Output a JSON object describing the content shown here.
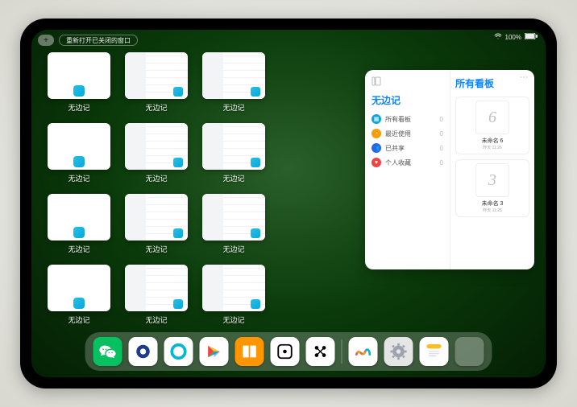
{
  "status": {
    "battery": "100%",
    "wifi": "●"
  },
  "top": {
    "reopen_label": "重新打开已关闭的窗口"
  },
  "app_label": "无边记",
  "windows": [
    {
      "type": "blank"
    },
    {
      "type": "cal"
    },
    {
      "type": "cal"
    },
    {
      "type": "blank"
    },
    {
      "type": "cal"
    },
    {
      "type": "cal"
    },
    {
      "type": "blank"
    },
    {
      "type": "cal"
    },
    {
      "type": "cal"
    },
    {
      "type": "blank"
    },
    {
      "type": "cal"
    },
    {
      "type": "cal"
    }
  ],
  "panel": {
    "left_title": "无边记",
    "items": [
      {
        "icon": "grid",
        "color": "#0ea5d9",
        "label": "所有看板",
        "count": "0"
      },
      {
        "icon": "clock",
        "color": "#f59e0b",
        "label": "最近使用",
        "count": "0"
      },
      {
        "icon": "share",
        "color": "#2563eb",
        "label": "已共享",
        "count": "0"
      },
      {
        "icon": "heart",
        "color": "#ef4444",
        "label": "个人收藏",
        "count": "0"
      }
    ],
    "right_title": "所有看板",
    "boards": [
      {
        "glyph": "6",
        "title": "未命名 6",
        "sub": "昨天 11:26"
      },
      {
        "glyph": "3",
        "title": "未命名 3",
        "sub": "昨天 11:25"
      }
    ]
  },
  "dock": {
    "apps": [
      {
        "name": "wechat",
        "bg": "#07c160",
        "glyph": "wechat"
      },
      {
        "name": "browser1",
        "bg": "#ffffff",
        "glyph": "circle-blue"
      },
      {
        "name": "browser2",
        "bg": "#ffffff",
        "glyph": "circle-cyan"
      },
      {
        "name": "play",
        "bg": "#ffffff",
        "glyph": "play-color"
      },
      {
        "name": "books",
        "bg": "#ff9500",
        "glyph": "book"
      },
      {
        "name": "dice",
        "bg": "#ffffff",
        "glyph": "dice"
      },
      {
        "name": "dots",
        "bg": "#ffffff",
        "glyph": "dots"
      }
    ],
    "recent": [
      {
        "name": "freeform",
        "bg": "#ffffff",
        "glyph": "freeform"
      },
      {
        "name": "settings",
        "bg": "#e5e5e5",
        "glyph": "gear"
      },
      {
        "name": "notes",
        "bg": "#ffffff",
        "glyph": "notes"
      },
      {
        "name": "folder",
        "bg": "#ffffff",
        "glyph": "multi"
      }
    ]
  }
}
